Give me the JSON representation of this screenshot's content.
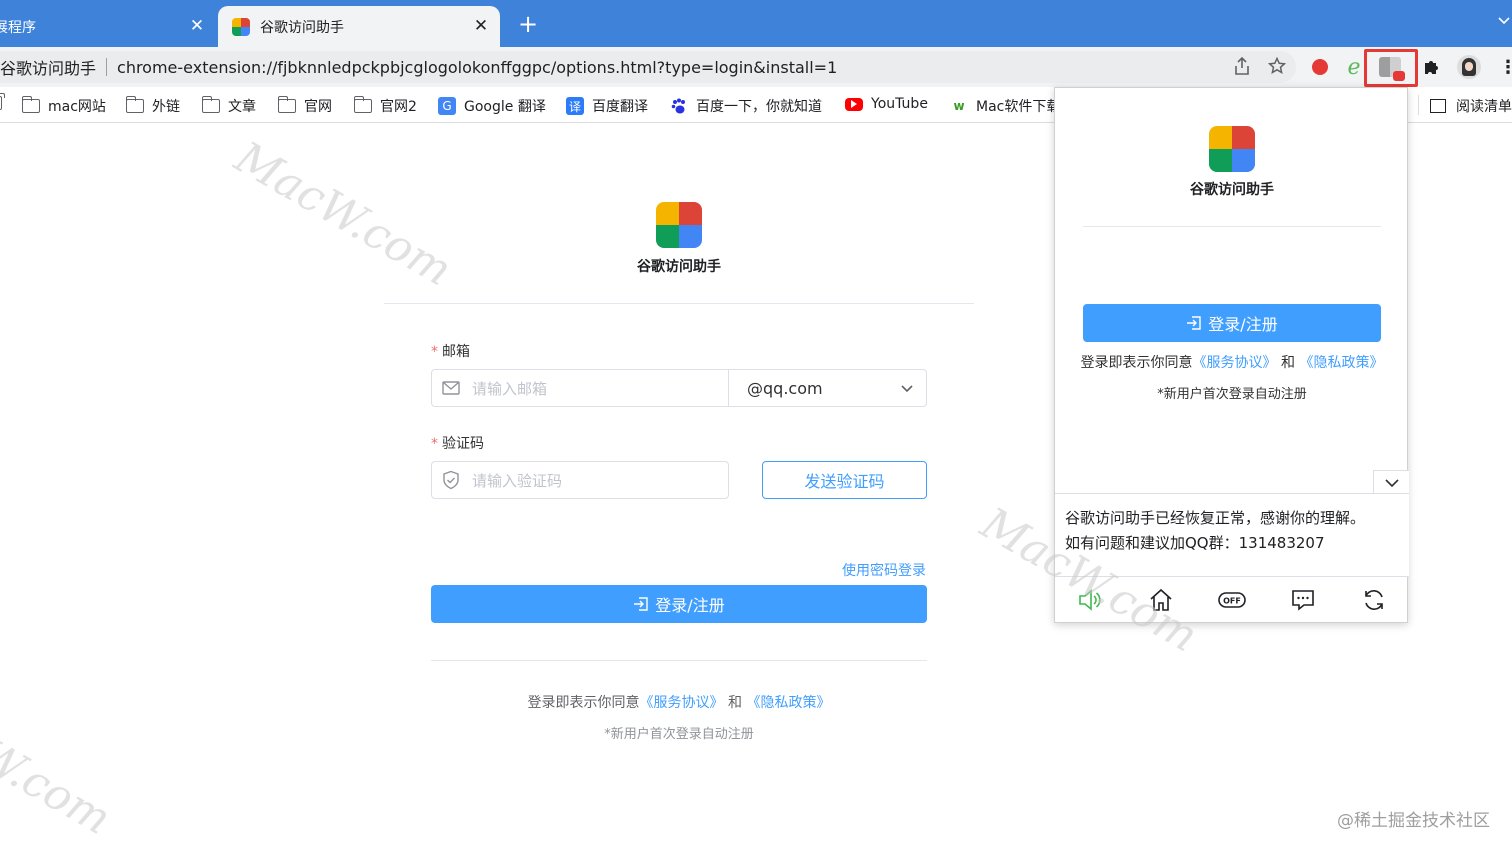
{
  "tabs": [
    {
      "title": "展程序",
      "close": "✕"
    },
    {
      "title": "谷歌访问助手",
      "close": "✕"
    }
  ],
  "new_tab": "+",
  "omnibox": {
    "site_name": "谷歌访问助手",
    "url": "chrome-extension://fjbknnledpckpbjcglogolokonffggpc/options.html?type=login&install=1"
  },
  "bookmarks": [
    {
      "label": "mac网站",
      "icon": "folder-icon"
    },
    {
      "label": "外链",
      "icon": "folder-icon"
    },
    {
      "label": "文章",
      "icon": "folder-icon"
    },
    {
      "label": "官网",
      "icon": "folder-icon"
    },
    {
      "label": "官网2",
      "icon": "folder-icon"
    },
    {
      "label": "Google 翻译",
      "icon": "google-translate-icon"
    },
    {
      "label": "百度翻译",
      "icon": "baidu-translate-icon",
      "icon_text": "译"
    },
    {
      "label": "百度一下，你就知道",
      "icon": "baidu-paw-icon"
    },
    {
      "label": "YouTube",
      "icon": "youtube-icon"
    },
    {
      "label": "Mac软件下载",
      "icon": "mac-software-icon",
      "icon_text": "w"
    }
  ],
  "reading_list": "阅读清单",
  "main": {
    "app_title": "谷歌访问助手",
    "email": {
      "required_mark": "*",
      "label": "邮箱",
      "placeholder": "请输入邮箱",
      "domain": "@qq.com"
    },
    "code": {
      "required_mark": "*",
      "label": "验证码",
      "placeholder": "请输入验证码"
    },
    "send_code": "发送验证码",
    "password_login": "使用密码登录",
    "login_button": "登录/注册",
    "agree_prefix": "登录即表示你同意",
    "terms_link": "《服务协议》",
    "and": "和",
    "privacy_link": "《隐私政策》",
    "new_user_note": "*新用户首次登录自动注册"
  },
  "popup": {
    "title": "谷歌访问助手",
    "login_button": "登录/注册",
    "agree_prefix": "登录即表示你同意",
    "terms_link": "《服务协议》",
    "and": "和",
    "privacy_link": "《隐私政策》",
    "new_user_note": "*新用户首次登录自动注册",
    "notice_line1": "谷歌访问助手已经恢复正常，感谢你的理解。",
    "notice_line2": "如有问题和建议加QQ群：131483207",
    "actions": [
      "speaker-icon",
      "home-icon",
      "off-toggle-icon",
      "message-icon",
      "refresh-icon"
    ],
    "off_label": "OFF"
  },
  "watermarks": [
    "MacW.com",
    "MacW.com",
    "rW.com"
  ],
  "footer_watermark": "@稀土掘金技术社区",
  "colors": {
    "tab_strip": "#3f82d9",
    "primary": "#409eff",
    "required": "#f56c6c",
    "highlight": "#e53935"
  }
}
